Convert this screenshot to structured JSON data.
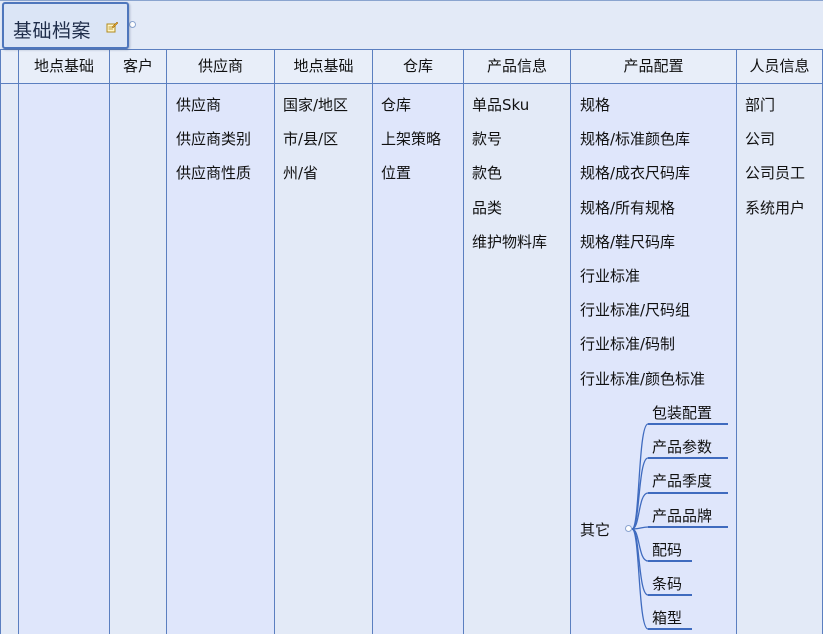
{
  "root": {
    "title": "基础档案",
    "note_icon": "note-pencil-icon"
  },
  "columns": [
    {
      "header": "",
      "items": []
    },
    {
      "header": "地点基础",
      "items": []
    },
    {
      "header": "客户",
      "items": []
    },
    {
      "header": "供应商",
      "items": [
        "供应商",
        "供应商类别",
        "供应商性质"
      ]
    },
    {
      "header": "地点基础",
      "items": [
        "国家/地区",
        "市/县/区",
        "州/省"
      ]
    },
    {
      "header": "仓库",
      "items": [
        "仓库",
        "上架策略",
        "位置"
      ]
    },
    {
      "header": "产品信息",
      "items": [
        "单品Sku",
        "款号",
        "款色",
        "品类",
        "维护物料库"
      ]
    },
    {
      "header": "产品配置",
      "items": [
        "规格",
        "规格/标准颜色库",
        "规格/成衣尺码库",
        "规格/所有规格",
        "规格/鞋尺码库",
        "行业标准",
        "行业标准/尺码组",
        "行业标准/码制",
        "行业标准/颜色标准"
      ]
    },
    {
      "header": "人员信息",
      "items": [
        "部门",
        "公司",
        "公司员工",
        "系统用户"
      ]
    }
  ],
  "other": {
    "label": "其它",
    "children": [
      "包装配置",
      "产品参数",
      "产品季度",
      "产品品牌",
      "配码",
      "条码",
      "箱型"
    ]
  },
  "colors": {
    "line": "#5b7fc0",
    "branch": "#3f6bbf",
    "background": "#e3eaf7"
  }
}
